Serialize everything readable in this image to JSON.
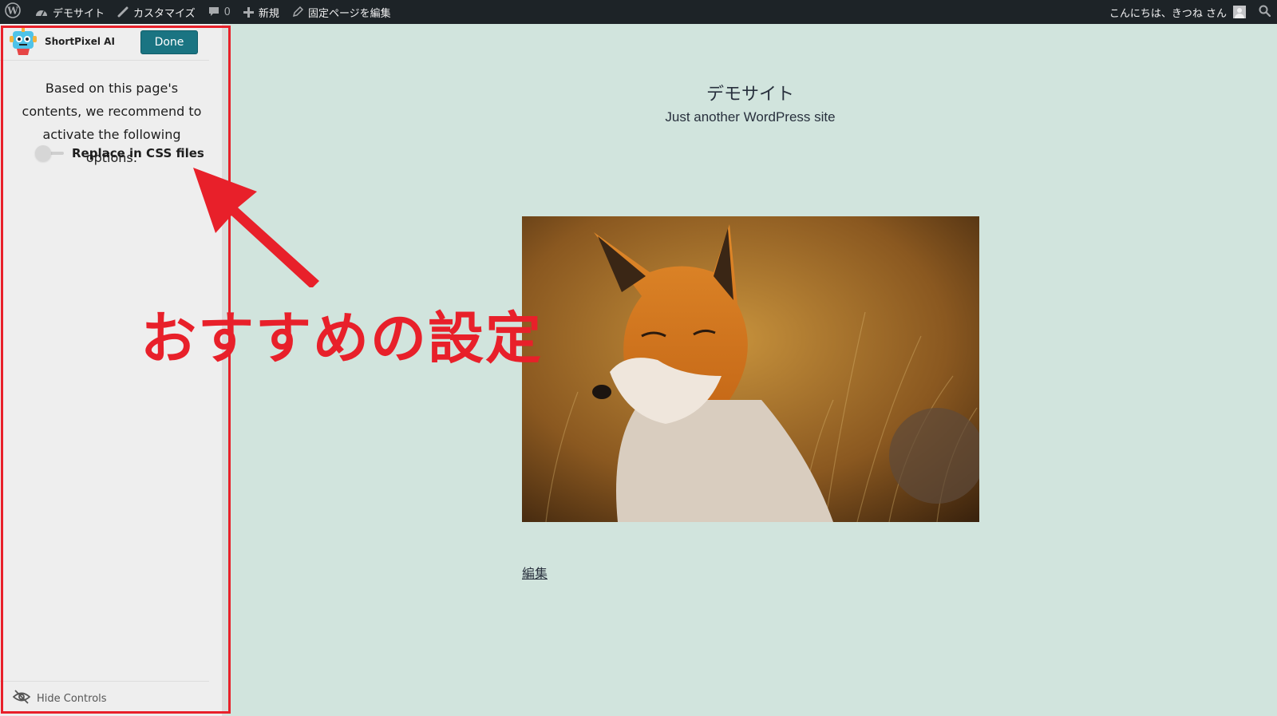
{
  "admin_bar": {
    "site_name": "デモサイト",
    "customize": "カスタマイズ",
    "comments_count": "0",
    "new": "新規",
    "edit_page": "固定ページを編集",
    "greeting": "こんにちは、きつね さん"
  },
  "panel": {
    "plugin_name": "ShortPixel AI",
    "done_label": "Done",
    "recommend_text": "Based on this page's contents, we recommend to activate the following options:",
    "option_label": "Replace in CSS files",
    "option_enabled": false,
    "hide_controls": "Hide Controls"
  },
  "site": {
    "title": "デモサイト",
    "tagline": "Just another WordPress site",
    "edit_link": "編集"
  },
  "annotation": {
    "text": "おすすめの設定",
    "color": "#e8202a"
  },
  "colors": {
    "admin_bar": "#1d2327",
    "page_bg": "#d1e4dd",
    "panel_bg": "#eeeeee",
    "done_button": "#1a7482"
  }
}
